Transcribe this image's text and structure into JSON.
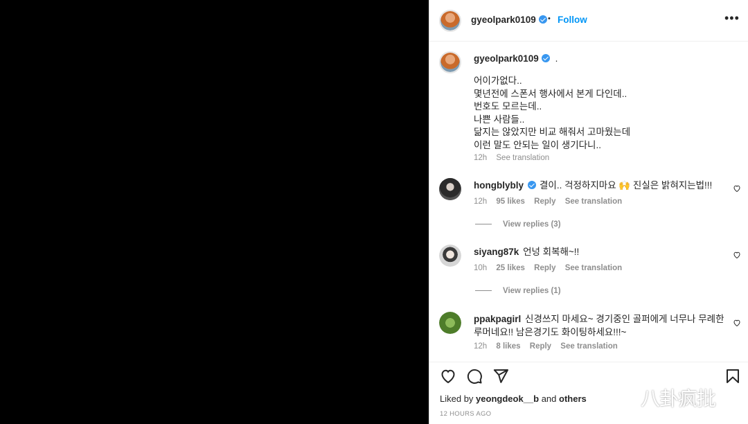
{
  "post": {
    "author": "gyeolpark0109",
    "follow_label": "Follow",
    "dot_separator": "•",
    "more_label": "•••"
  },
  "caption": {
    "author": "gyeolpark0109",
    "title_dot": ".",
    "body": "어이가없다..\n몇년전에 스폰서 행사에서 본게 다인데..\n번호도 모르는데..\n나쁜 사람들..\n닮지는 않았지만 비교 해줘서 고마웠는데\n이런 말도 안되는 일이 생기다니..",
    "time": "12h",
    "see_translation": "See translation"
  },
  "comments": [
    {
      "username": "hongblybly",
      "verified": true,
      "text": "결이.. 걱정하지마요 🙌 진실은 밝혀지는법!!!",
      "time": "12h",
      "likes": "95 likes",
      "reply": "Reply",
      "see_translation": "See translation",
      "view_replies": "View replies (3)",
      "avatar_color": "#3a3a3a"
    },
    {
      "username": "siyang87k",
      "verified": false,
      "text": "언넝 회복해~!!",
      "time": "10h",
      "likes": "25 likes",
      "reply": "Reply",
      "see_translation": "See translation",
      "view_replies": "View replies (1)",
      "avatar_color": "#b9b9b9"
    },
    {
      "username": "ppakpagirl",
      "verified": false,
      "text": "신경쓰지 마세요~ 경기중인 골퍼에게 너무나 무례한 루머네요!! 남은경기도 화이팅하세요!!!~",
      "time": "12h",
      "likes": "8 likes",
      "reply": "Reply",
      "see_translation": "See translation",
      "avatar_color": "#5f8f3a"
    }
  ],
  "actions": {
    "like_icon": "heart-icon",
    "comment_icon": "comment-icon",
    "share_icon": "share-icon",
    "save_icon": "bookmark-icon"
  },
  "likes": {
    "prefix": "Liked by",
    "user": "yeongdeok__b",
    "and": "and",
    "others": "others"
  },
  "posted": "12 HOURS AGO",
  "watermark": "八卦疯批",
  "colors": {
    "accent": "#0095f6",
    "verified": "#3897f0",
    "muted": "#8e8e8e",
    "text": "#262626"
  }
}
